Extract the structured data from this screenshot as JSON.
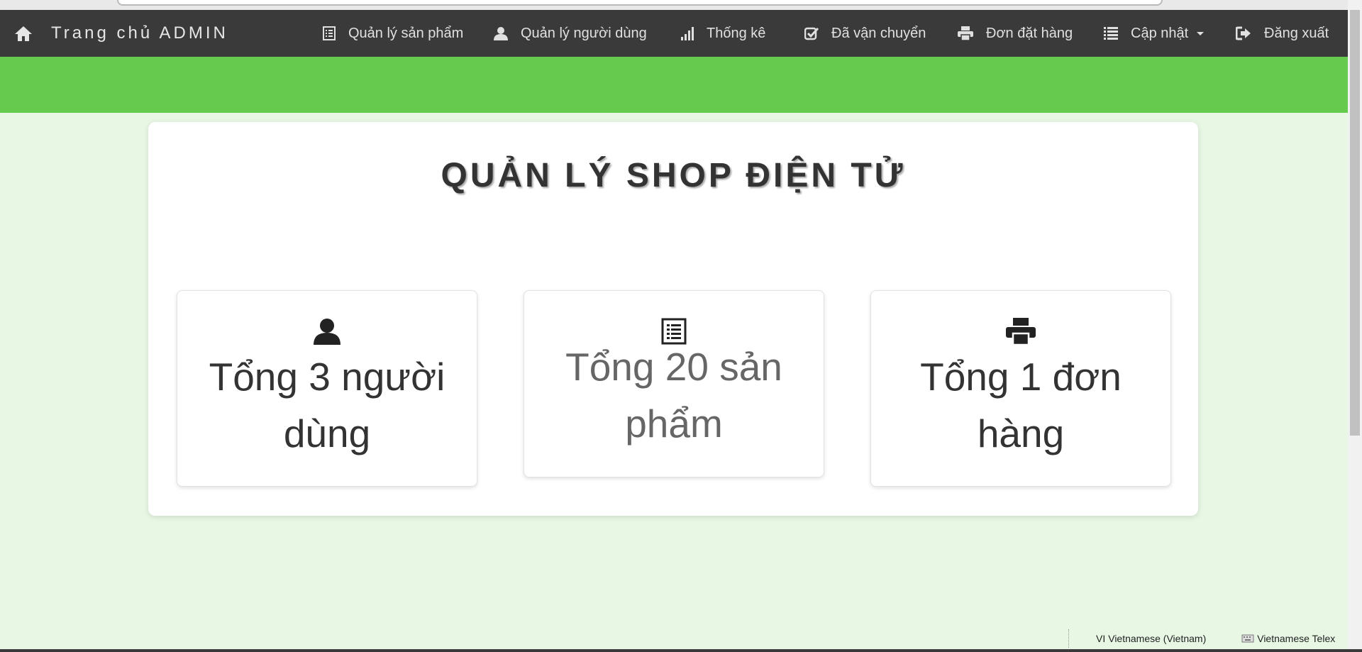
{
  "navbar": {
    "brand": "Trang chủ ADMIN",
    "items": [
      {
        "label": "Quản lý sản phẩm",
        "icon": "list-alt-icon"
      },
      {
        "label": "Quản lý người dùng",
        "icon": "user-icon"
      },
      {
        "label": "Thống kê",
        "icon": "signal-bars-icon"
      },
      {
        "label": "Đã vận chuyển",
        "icon": "check-square-icon"
      },
      {
        "label": "Đơn đặt hàng",
        "icon": "printer-icon"
      },
      {
        "label": "Cập nhật",
        "icon": "list-icon"
      },
      {
        "label": "Đăng xuất",
        "icon": "logout-icon"
      }
    ]
  },
  "main": {
    "title": "QUẢN LÝ SHOP ĐIỆN TỬ",
    "cards": [
      {
        "text": "Tổng 3 người dùng",
        "icon": "user-icon"
      },
      {
        "text": "Tổng 20 sản phẩm",
        "icon": "list-alt-icon"
      },
      {
        "text": "Tổng 1 đơn hàng",
        "icon": "printer-icon"
      }
    ]
  },
  "status_bar": {
    "language_code": "VI",
    "language": "Vietnamese (Vietnam)",
    "input_method": "Vietnamese Telex"
  },
  "colors": {
    "navbar": "#3a3a3a",
    "accent_green": "#66ca4f",
    "page_background": "#e8f7e4"
  }
}
